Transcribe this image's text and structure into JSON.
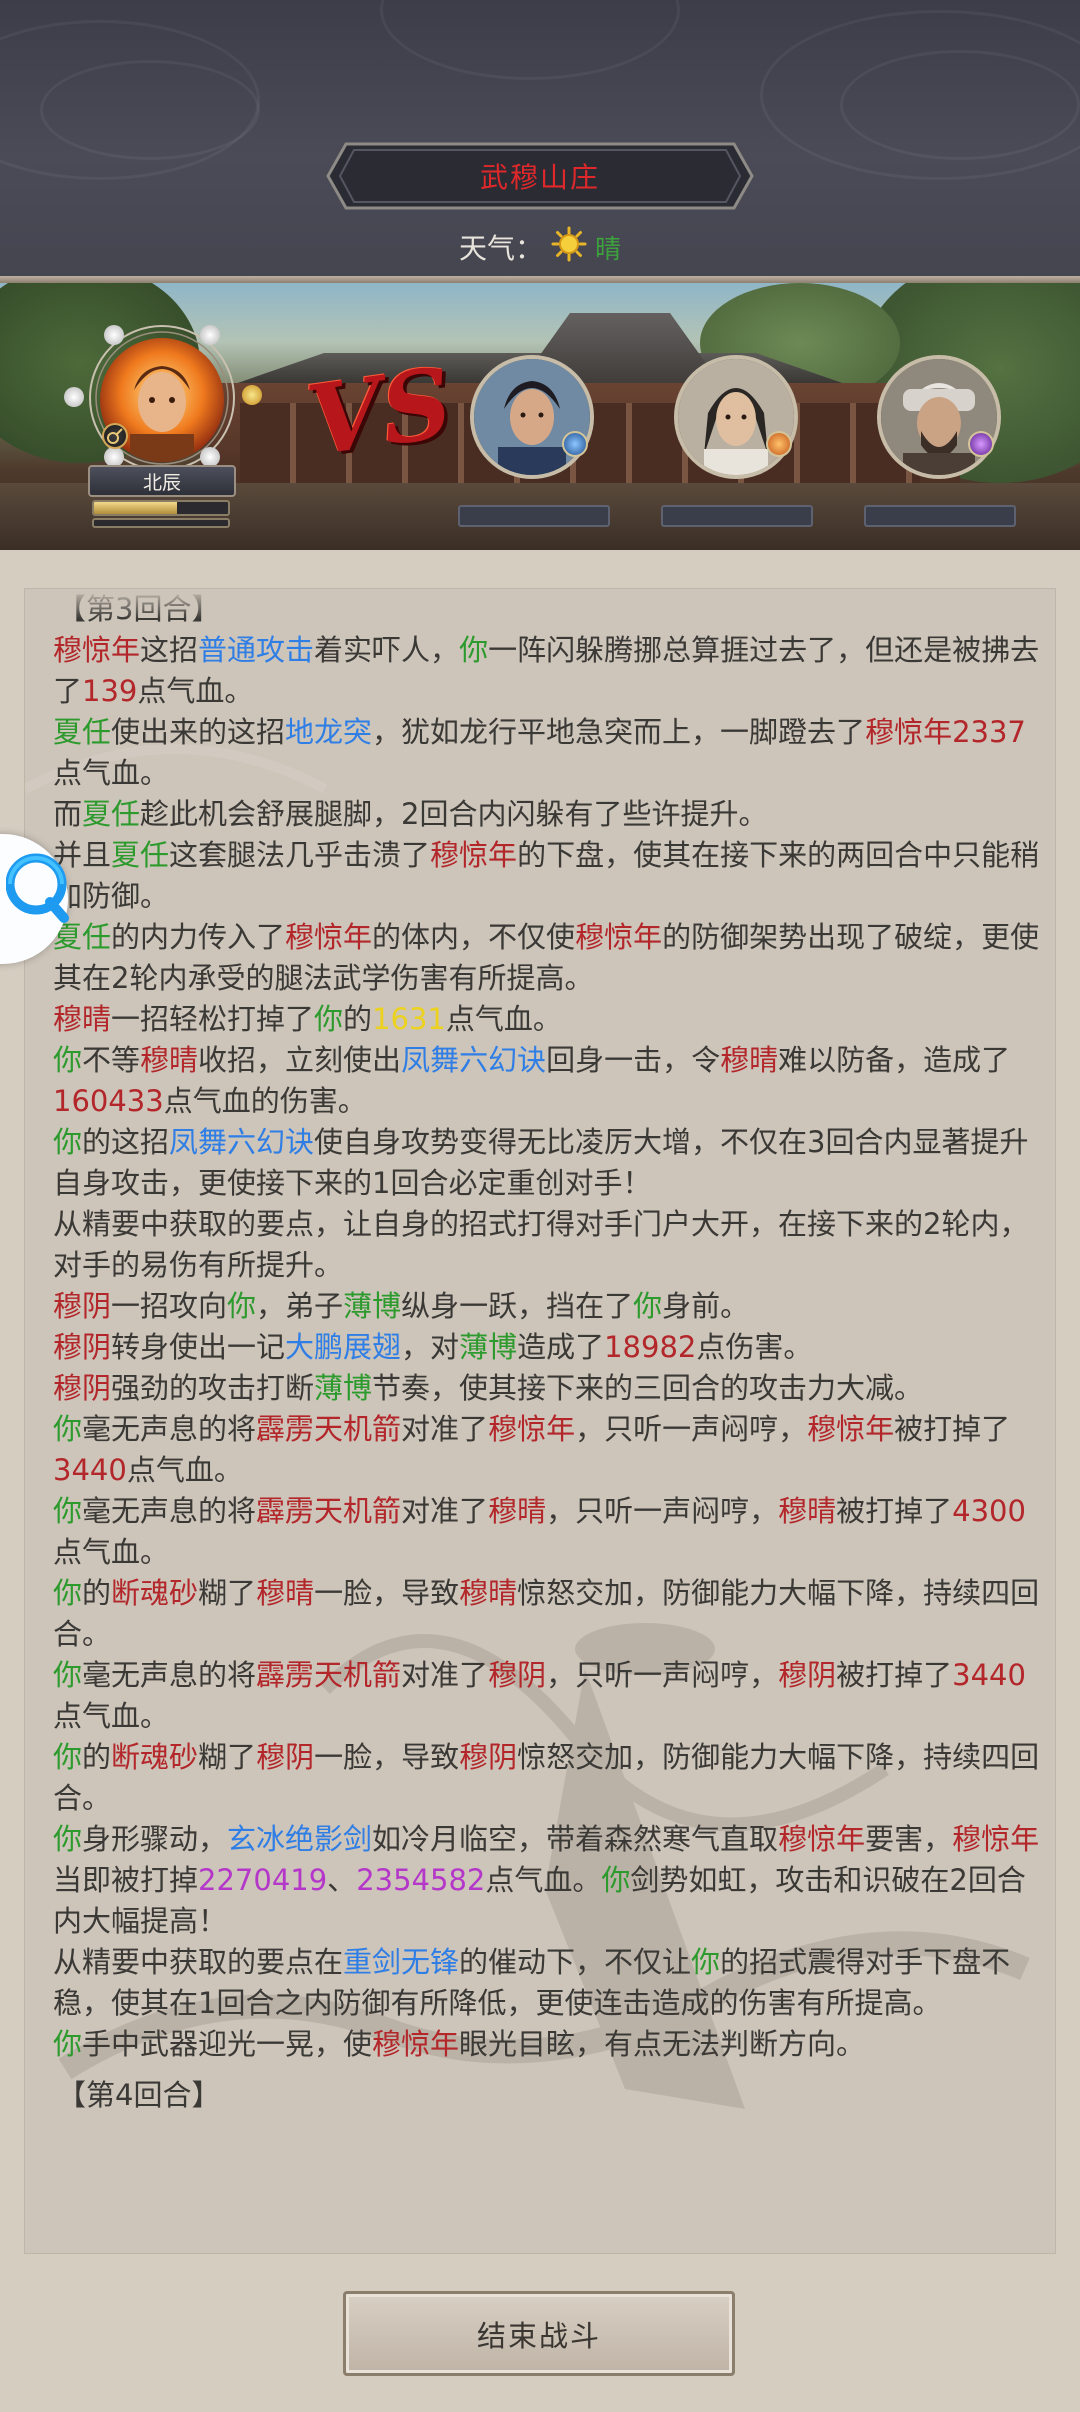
{
  "header": {
    "location_title": "武穆山庄",
    "weather_label": "天气：",
    "weather_value": "晴",
    "weather_icon": "sun-icon"
  },
  "battle": {
    "player_name": "北辰",
    "player_hp_fraction": 0.62,
    "vs_text": "VS",
    "enemy_count": 3
  },
  "log": {
    "lines": [
      [
        {
          "t": "【第3回合】",
          "c": ""
        }
      ],
      [
        {
          "t": "穆惊年",
          "c": "red"
        },
        {
          "t": "这招",
          "c": ""
        },
        {
          "t": "普通攻击",
          "c": "blue"
        },
        {
          "t": "着实吓人，",
          "c": ""
        },
        {
          "t": "你",
          "c": "green"
        },
        {
          "t": "一阵闪躲腾挪总算捱过去了，但还是被拂去了",
          "c": ""
        },
        {
          "t": "139",
          "c": "red"
        },
        {
          "t": "点气血。",
          "c": ""
        }
      ],
      [
        {
          "t": "夏任",
          "c": "green"
        },
        {
          "t": "使出来的这招",
          "c": ""
        },
        {
          "t": "地龙突",
          "c": "blue"
        },
        {
          "t": "，犹如龙行平地急突而上，一脚蹬去了",
          "c": ""
        },
        {
          "t": "穆惊年",
          "c": "red"
        },
        {
          "t": "2337",
          "c": "red"
        },
        {
          "t": "点气血。",
          "c": ""
        }
      ],
      [
        {
          "t": "而",
          "c": ""
        },
        {
          "t": "夏任",
          "c": "green"
        },
        {
          "t": "趁此机会舒展腿脚，2回合内闪躲有了些许提升。",
          "c": ""
        }
      ],
      [
        {
          "t": "并且",
          "c": ""
        },
        {
          "t": "夏任",
          "c": "green"
        },
        {
          "t": "这套腿法几乎击溃了",
          "c": ""
        },
        {
          "t": "穆惊年",
          "c": "red"
        },
        {
          "t": "的下盘，使其在接下来的两回合中只能稍加防御。",
          "c": ""
        }
      ],
      [
        {
          "t": "夏任",
          "c": "green"
        },
        {
          "t": "的内力传入了",
          "c": ""
        },
        {
          "t": "穆惊年",
          "c": "red"
        },
        {
          "t": "的体内，不仅使",
          "c": ""
        },
        {
          "t": "穆惊年",
          "c": "red"
        },
        {
          "t": "的防御架势出现了破绽，更使其在2轮内承受的腿法武学伤害有所提高。",
          "c": ""
        }
      ],
      [
        {
          "t": "穆晴",
          "c": "red"
        },
        {
          "t": "一招轻松打掉了",
          "c": ""
        },
        {
          "t": "你",
          "c": "green"
        },
        {
          "t": "的",
          "c": ""
        },
        {
          "t": "1631",
          "c": "yellow"
        },
        {
          "t": "点气血。",
          "c": ""
        }
      ],
      [
        {
          "t": "你",
          "c": "green"
        },
        {
          "t": "不等",
          "c": ""
        },
        {
          "t": "穆晴",
          "c": "red"
        },
        {
          "t": "收招，立刻使出",
          "c": ""
        },
        {
          "t": "凤舞六幻诀",
          "c": "blue"
        },
        {
          "t": "回身一击，令",
          "c": ""
        },
        {
          "t": "穆晴",
          "c": "red"
        },
        {
          "t": "难以防备，造成了",
          "c": ""
        },
        {
          "t": "160433",
          "c": "red"
        },
        {
          "t": "点气血的伤害。",
          "c": ""
        }
      ],
      [
        {
          "t": "你",
          "c": "green"
        },
        {
          "t": "的这招",
          "c": ""
        },
        {
          "t": "凤舞六幻诀",
          "c": "blue"
        },
        {
          "t": "使自身攻势变得无比凌厉大增，不仅在3回合内显著提升自身攻击，更使接下来的1回合必定重创对手！",
          "c": ""
        }
      ],
      [
        {
          "t": "从精要中获取的要点，让自身的招式打得对手门户大开，在接下来的2轮内，对手的易伤有所提升。",
          "c": ""
        }
      ],
      [
        {
          "t": "穆阴",
          "c": "red"
        },
        {
          "t": "一招攻向",
          "c": ""
        },
        {
          "t": "你",
          "c": "green"
        },
        {
          "t": "，弟子",
          "c": ""
        },
        {
          "t": "薄博",
          "c": "green"
        },
        {
          "t": "纵身一跃，挡在了",
          "c": ""
        },
        {
          "t": "你",
          "c": "green"
        },
        {
          "t": "身前。",
          "c": ""
        }
      ],
      [
        {
          "t": "穆阴",
          "c": "red"
        },
        {
          "t": "转身使出一记",
          "c": ""
        },
        {
          "t": "大鹏展翅",
          "c": "blue"
        },
        {
          "t": "，对",
          "c": ""
        },
        {
          "t": "薄博",
          "c": "green"
        },
        {
          "t": "造成了",
          "c": ""
        },
        {
          "t": "18982",
          "c": "red"
        },
        {
          "t": "点伤害。",
          "c": ""
        }
      ],
      [
        {
          "t": "穆阴",
          "c": "red"
        },
        {
          "t": "强劲的攻击打断",
          "c": ""
        },
        {
          "t": "薄博",
          "c": "green"
        },
        {
          "t": "节奏，使其接下来的三回合的攻击力大减。",
          "c": ""
        }
      ],
      [
        {
          "t": "你",
          "c": "green"
        },
        {
          "t": "毫无声息的将",
          "c": ""
        },
        {
          "t": "霹雳天机箭",
          "c": "red"
        },
        {
          "t": "对准了",
          "c": ""
        },
        {
          "t": "穆惊年",
          "c": "red"
        },
        {
          "t": "，只听一声闷哼，",
          "c": ""
        },
        {
          "t": "穆惊年",
          "c": "red"
        },
        {
          "t": "被打掉了",
          "c": ""
        },
        {
          "t": "3440",
          "c": "red"
        },
        {
          "t": "点气血。",
          "c": ""
        }
      ],
      [
        {
          "t": "你",
          "c": "green"
        },
        {
          "t": "毫无声息的将",
          "c": ""
        },
        {
          "t": "霹雳天机箭",
          "c": "red"
        },
        {
          "t": "对准了",
          "c": ""
        },
        {
          "t": "穆晴",
          "c": "red"
        },
        {
          "t": "，只听一声闷哼，",
          "c": ""
        },
        {
          "t": "穆晴",
          "c": "red"
        },
        {
          "t": "被打掉了",
          "c": ""
        },
        {
          "t": "4300",
          "c": "red"
        },
        {
          "t": "点气血。",
          "c": ""
        }
      ],
      [
        {
          "t": "你",
          "c": "green"
        },
        {
          "t": "的",
          "c": ""
        },
        {
          "t": "断魂砂",
          "c": "red"
        },
        {
          "t": "糊了",
          "c": ""
        },
        {
          "t": "穆晴",
          "c": "red"
        },
        {
          "t": "一脸，导致",
          "c": ""
        },
        {
          "t": "穆晴",
          "c": "red"
        },
        {
          "t": "惊怒交加，防御能力大幅下降，持续四回合。",
          "c": ""
        }
      ],
      [
        {
          "t": "你",
          "c": "green"
        },
        {
          "t": "毫无声息的将",
          "c": ""
        },
        {
          "t": "霹雳天机箭",
          "c": "red"
        },
        {
          "t": "对准了",
          "c": ""
        },
        {
          "t": "穆阴",
          "c": "red"
        },
        {
          "t": "，只听一声闷哼，",
          "c": ""
        },
        {
          "t": "穆阴",
          "c": "red"
        },
        {
          "t": "被打掉了",
          "c": ""
        },
        {
          "t": "3440",
          "c": "red"
        },
        {
          "t": "点气血。",
          "c": ""
        }
      ],
      [
        {
          "t": "你",
          "c": "green"
        },
        {
          "t": "的",
          "c": ""
        },
        {
          "t": "断魂砂",
          "c": "red"
        },
        {
          "t": "糊了",
          "c": ""
        },
        {
          "t": "穆阴",
          "c": "red"
        },
        {
          "t": "一脸，导致",
          "c": ""
        },
        {
          "t": "穆阴",
          "c": "red"
        },
        {
          "t": "惊怒交加，防御能力大幅下降，持续四回合。",
          "c": ""
        }
      ],
      [
        {
          "t": "你",
          "c": "green"
        },
        {
          "t": "身形骤动，",
          "c": ""
        },
        {
          "t": "玄冰绝影剑",
          "c": "blue"
        },
        {
          "t": "如冷月临空，带着森然寒气直取",
          "c": ""
        },
        {
          "t": "穆惊年",
          "c": "red"
        },
        {
          "t": "要害，",
          "c": ""
        },
        {
          "t": "穆惊年",
          "c": "red"
        },
        {
          "t": "当即被打掉",
          "c": ""
        },
        {
          "t": "2270419",
          "c": "purple"
        },
        {
          "t": "、",
          "c": ""
        },
        {
          "t": "2354582",
          "c": "purple"
        },
        {
          "t": "点气血。",
          "c": ""
        },
        {
          "t": "你",
          "c": "green"
        },
        {
          "t": "剑势如虹，攻击和识破在2回合内大幅提高！",
          "c": ""
        }
      ],
      [
        {
          "t": "从精要中获取的要点在",
          "c": ""
        },
        {
          "t": "重剑无锋",
          "c": "blue"
        },
        {
          "t": "的催动下，不仅让",
          "c": ""
        },
        {
          "t": "你",
          "c": "green"
        },
        {
          "t": "的招式震得对手下盘不稳，使其在1回合之内防御有所降低，更使连击造成的伤害有所提高。",
          "c": ""
        }
      ],
      [
        {
          "t": "你",
          "c": "green"
        },
        {
          "t": "手中武器迎光一晃，使",
          "c": ""
        },
        {
          "t": "穆惊年",
          "c": "red"
        },
        {
          "t": "眼光目眩，有点无法判断方向。",
          "c": ""
        }
      ],
      [
        {
          "t": "【第4回合】",
          "c": ""
        }
      ]
    ]
  },
  "footer": {
    "end_button_label": "结束战斗"
  },
  "colors": {
    "title_red": "#e0282b",
    "name_red": "#b3262a",
    "ally_green": "#2d9a2d",
    "skill_blue": "#2f7ee6",
    "damage_yellow": "#ecd21e",
    "crit_purple": "#b437c9"
  }
}
